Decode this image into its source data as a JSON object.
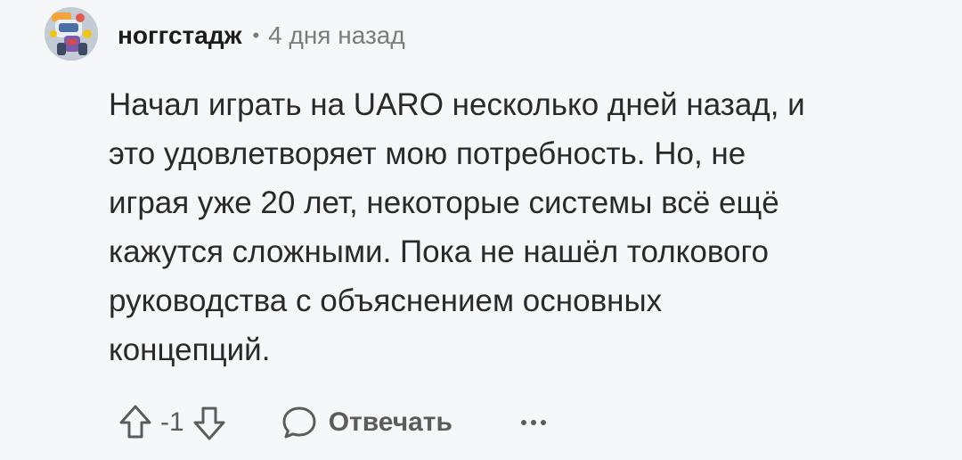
{
  "comment": {
    "username": "ноггстадж",
    "separator": "•",
    "timestamp": "4 дня назад",
    "text": "Начал играть на UARO несколько дней назад, и\nэто удовлетворяет мою потребность. Но, не\nиграя уже 20 лет, некоторые системы всё ещё\nкажутся сложными. Пока не нашёл толкового\nруководства с объяснением основных\nконцепций.",
    "score": "-1"
  },
  "actions": {
    "reply_label": "Отвечать"
  },
  "icons": {
    "avatar": "avatar-image",
    "upvote": "arrow-up-outline-icon",
    "downvote": "arrow-down-outline-icon",
    "reply": "chat-bubble-icon",
    "more": "more-horizontal-icon"
  },
  "colors": {
    "background": "#f6f7f8",
    "text_primary": "#1c1c1c",
    "text_secondary": "#7c7c7c",
    "action_gray": "#5c5c5c"
  }
}
